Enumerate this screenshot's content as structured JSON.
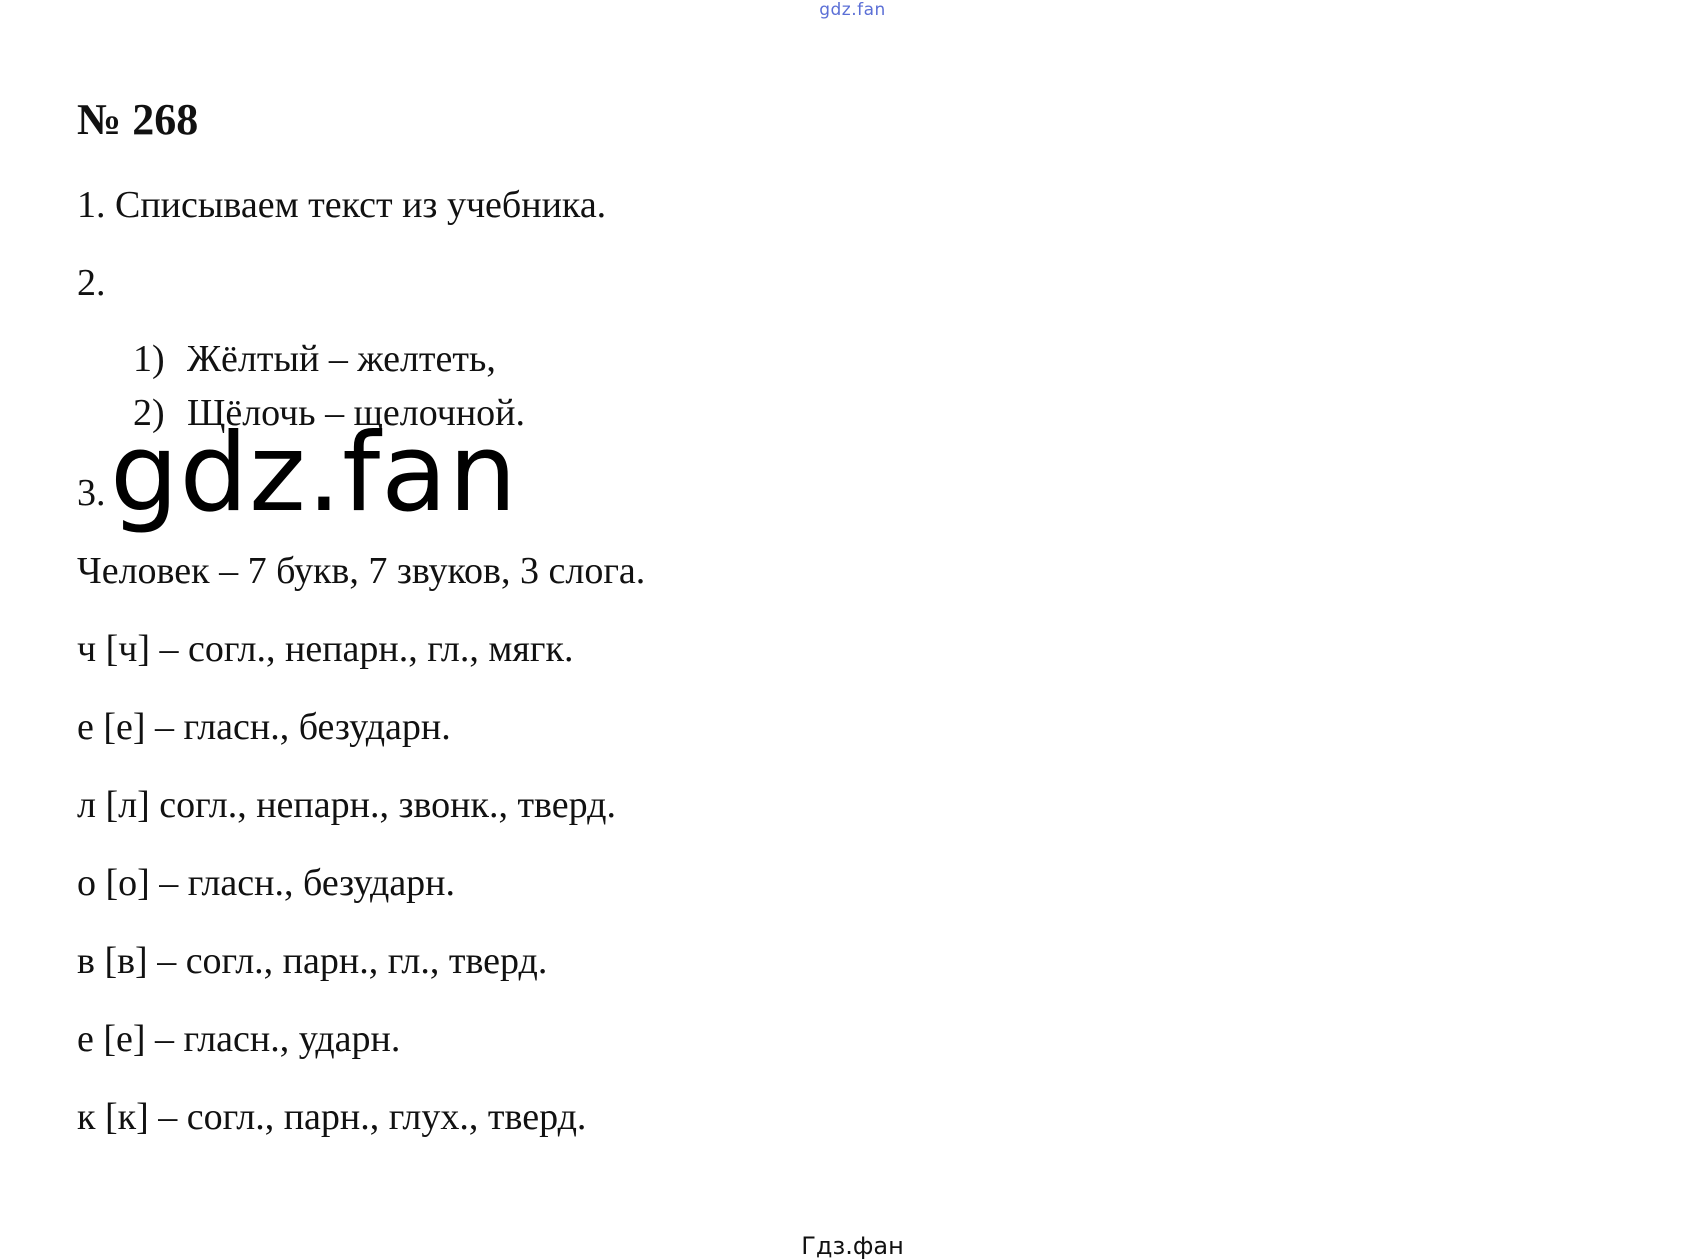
{
  "watermark": {
    "top": "gdz.fan",
    "center": "gdz.fan",
    "footer": "Гдз.фан"
  },
  "task": {
    "number": "№ 268",
    "step1": "1. Списываем текст из учебника.",
    "step2": "2.",
    "pairs": [
      {
        "num": "1)",
        "text": "Жёлтый – желтеть,"
      },
      {
        "num": "2)",
        "text": "Щёлочь – щелочной."
      }
    ],
    "step3": "3.",
    "word_summary": "Человек – 7 букв, 7 звуков, 3 слога.",
    "letters": [
      "ч [ч] – согл., непарн., гл., мягк.",
      "е [е] – гласн., безударн.",
      "л [л] согл., непарн., звонк., тверд.",
      "о [о] – гласн., безударн.",
      "в [в] – согл., парн., гл., тверд.",
      "е [е] – гласн., ударн.",
      "к [к] – согл., парн., глух., тверд."
    ]
  }
}
